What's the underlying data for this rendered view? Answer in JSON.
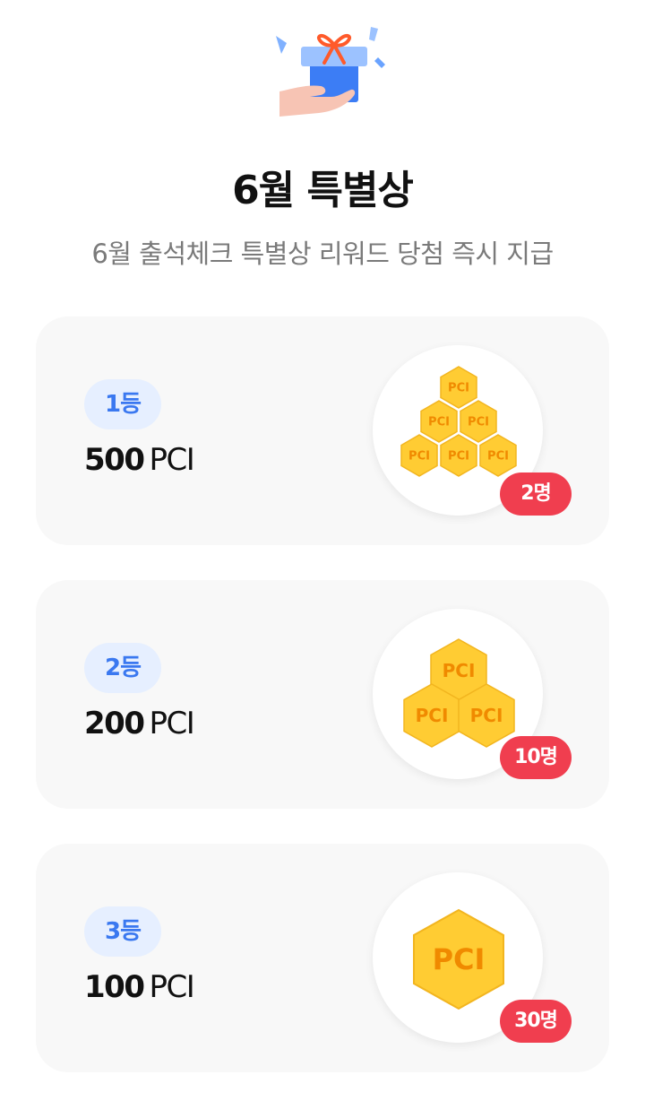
{
  "header": {
    "title": "6월 특별상",
    "subtitle": "6월 출석체크 특별상 리워드 당첨 즉시 지급",
    "icon": "gift-in-hand-icon"
  },
  "coin_label": "PCI",
  "colors": {
    "rank_text": "#3a78f0",
    "rank_bg": "#e6efff",
    "badge": "#f03e4f",
    "coin": "#ffcc33",
    "coin_text": "#f08a00",
    "card_bg": "#f8f8f8"
  },
  "prizes": [
    {
      "rank": "1등",
      "amount": "500",
      "unit": "PCI",
      "winners": "2명",
      "coins": 6
    },
    {
      "rank": "2등",
      "amount": "200",
      "unit": "PCI",
      "winners": "10명",
      "coins": 3
    },
    {
      "rank": "3등",
      "amount": "100",
      "unit": "PCI",
      "winners": "30명",
      "coins": 1
    }
  ]
}
